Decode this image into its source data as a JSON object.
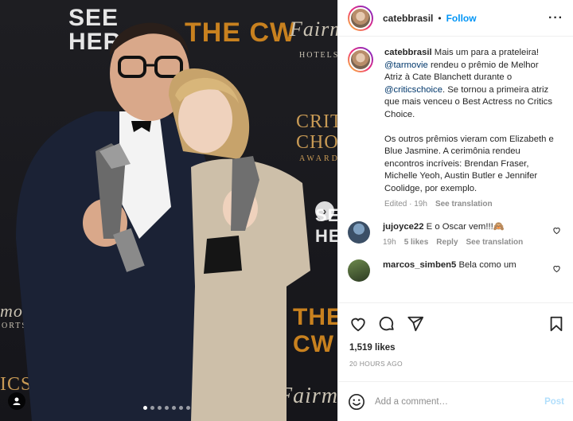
{
  "photo": {
    "backdrop_texts": [
      "SEE HER",
      "THE CW",
      "Fairmont",
      "HOTELS",
      "CRITICS",
      "CHOICE",
      "AWARDS",
      "SEE HER",
      "THE CW",
      "mont",
      "ORTS",
      "Fairm",
      "ICS"
    ],
    "carousel": {
      "count": 7,
      "active_index": 0
    },
    "next_arrow_icon": "chevron-right-icon",
    "user_tag_icon": "person-icon"
  },
  "post": {
    "username": "catebbrasil",
    "separator": "•",
    "follow_label": "Follow",
    "more_icon": "more-options-icon",
    "caption": {
      "username": "catebbrasil",
      "text_before_mention1": "Mais um para a prateleira!",
      "mention1": "@tarmovie",
      "text_after_mention1": "rendeu o prêmio de Melhor Atriz à Cate Blanchett durante o",
      "mention2": "@criticschoice",
      "text_after_mention2": ". Se tornou a primeira atriz que mais venceu o Best Actress no Critics Choice.",
      "paragraph2": "Os outros prêmios vieram com Elizabeth e Blue Jasmine. A cerimônia rendeu encontros incríveis: Brendan Fraser, Michelle Yeoh, Austin Butler e Jennifer Coolidge, por exemplo.",
      "edited": "Edited · 19h",
      "see_translation": "See translation"
    },
    "comments": [
      {
        "username": "jujoyce22",
        "text": "E o Oscar vem!!!🙈",
        "time": "19h",
        "likes": "5 likes",
        "reply": "Reply",
        "see_translation": "See translation"
      },
      {
        "username": "marcos_simben5",
        "text": "Bela como um",
        "time": "",
        "likes": "",
        "reply": "",
        "see_translation": ""
      }
    ],
    "likes": "1,519 likes",
    "time_ago": "20 HOURS AGO",
    "add_comment_placeholder": "Add a comment…",
    "post_label": "Post"
  },
  "colors": {
    "link_blue": "#0095f6",
    "mention_blue": "#00376b",
    "muted": "#8e8e8e",
    "post_disabled": "#b2dffc"
  }
}
